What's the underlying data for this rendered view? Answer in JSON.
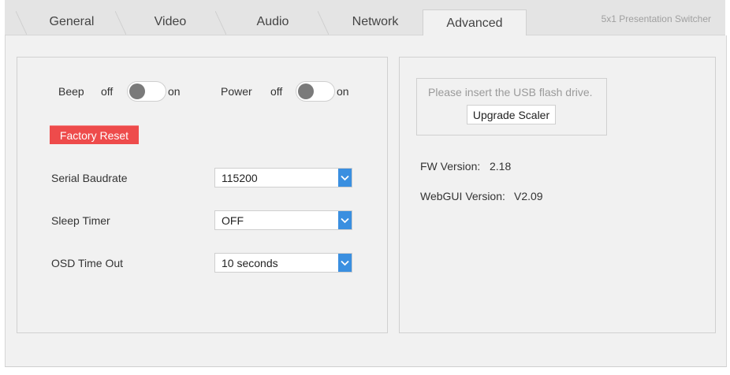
{
  "tabs": [
    {
      "label": "General"
    },
    {
      "label": "Video"
    },
    {
      "label": "Audio"
    },
    {
      "label": "Network"
    },
    {
      "label": "Advanced"
    }
  ],
  "active_tab": "Advanced",
  "brand": "5x1 Presentation Switcher",
  "settings": {
    "beep": {
      "label": "Beep",
      "off_label": "off",
      "on_label": "on",
      "state": "off"
    },
    "power": {
      "label": "Power",
      "off_label": "off",
      "on_label": "on",
      "state": "off"
    },
    "factory_reset_label": "Factory Reset",
    "serial_baudrate": {
      "label": "Serial Baudrate",
      "value": "115200"
    },
    "sleep_timer": {
      "label": "Sleep Timer",
      "value": "OFF"
    },
    "osd_time_out": {
      "label": "OSD Time Out",
      "value": "10 seconds"
    }
  },
  "firmware": {
    "usb_message": "Please insert the USB flash drive.",
    "upgrade_label": "Upgrade Scaler",
    "fw_version_label": "FW Version:",
    "fw_version": "2.18",
    "webgui_version_label": "WebGUI Version:",
    "webgui_version": "V2.09"
  },
  "colors": {
    "accent": "#3a8fe0",
    "reset": "#ee4b4b",
    "toggle_knob": "#7a7a7a"
  },
  "icons": {
    "dropdown": "chevron-down-icon"
  }
}
